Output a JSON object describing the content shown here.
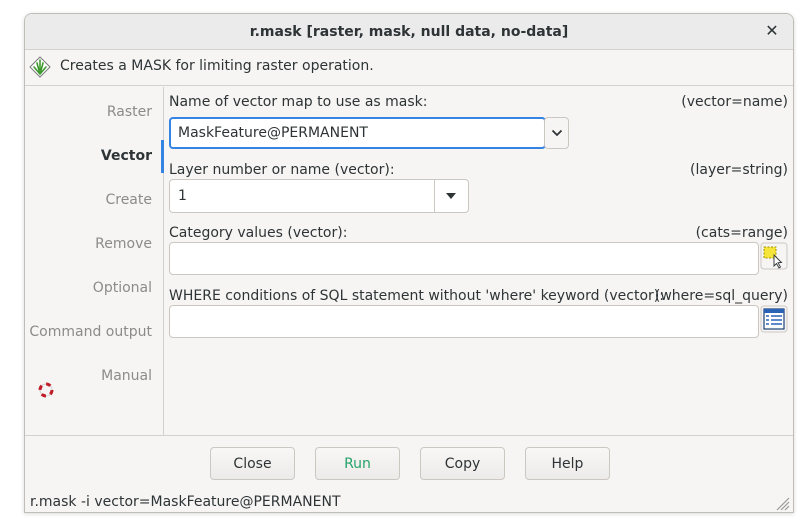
{
  "window": {
    "title": "r.mask [raster, mask, null data, no-data]",
    "close_glyph": "✕"
  },
  "description": {
    "icon": "grass-logo-icon",
    "text": "Creates a MASK for limiting raster operation."
  },
  "sidebar": {
    "active_tab": "Vector",
    "accent_color": "#3584e4",
    "items": [
      {
        "label": "Raster"
      },
      {
        "label": "Vector"
      },
      {
        "label": "Create"
      },
      {
        "label": "Remove"
      },
      {
        "label": "Optional"
      },
      {
        "label": "Command output"
      },
      {
        "label": "Manual",
        "icon": "lifebuoy-icon"
      }
    ]
  },
  "fields": {
    "vector": {
      "label": "Name of vector map to use as mask:",
      "param": "(vector=name)",
      "value": "MaskFeature@PERMANENT"
    },
    "layer": {
      "label": "Layer number or name (vector):",
      "param": "(layer=string)",
      "value": "1"
    },
    "cats": {
      "label": "Category values (vector):",
      "param": "(cats=range)",
      "value": ""
    },
    "where": {
      "label": "WHERE conditions of SQL statement without 'where' keyword (vector):",
      "param": "(where=sql_query)",
      "value": ""
    }
  },
  "buttons": {
    "close": "Close",
    "run": "Run",
    "copy": "Copy",
    "help": "Help",
    "run_color": "#26a269"
  },
  "statusbar": {
    "command": "r.mask -i vector=MaskFeature@PERMANENT"
  }
}
